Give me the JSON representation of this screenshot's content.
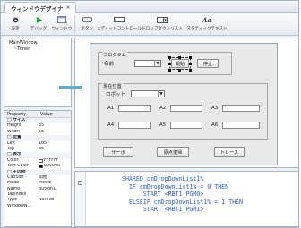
{
  "window": {
    "tab_title": "ウィンドウデザイナ",
    "close_glyph": "×"
  },
  "toolbar": {
    "items": [
      {
        "name": "settings",
        "icon": "gear-icon",
        "label": "設定"
      },
      {
        "name": "debug",
        "icon": "play-icon",
        "label": "デバッグ"
      },
      {
        "name": "window",
        "icon": "add-window-icon",
        "label": "ウィンドウ"
      },
      {
        "name": "button",
        "icon": "button-icon",
        "label": "ボタン"
      },
      {
        "name": "edit-control",
        "icon": "textbox-icon",
        "label": "エディットコントロール"
      },
      {
        "name": "dropdown-list",
        "icon": "dropdown-icon",
        "label": "ドロップダウンリスト"
      },
      {
        "name": "static-text",
        "icon": "text-icon",
        "label": "スタティックテキスト"
      }
    ]
  },
  "tree": {
    "items": [
      "MainWindow",
      "Timer"
    ]
  },
  "props": {
    "header": {
      "property": "Property",
      "value": "Value"
    },
    "rows": [
      {
        "k": "□ サイズ",
        "v": "",
        "cat": true
      },
      {
        "k": "Height",
        "v": "35"
      },
      {
        "k": "Width",
        "v": "55"
      },
      {
        "k": "□ 位置",
        "v": "",
        "cat": true
      },
      {
        "k": "Left",
        "v": "185"
      },
      {
        "k": "Top",
        "v": "35"
      },
      {
        "k": "□ 表示",
        "v": "",
        "cat": true
      },
      {
        "k": "Color",
        "v": "FFFFFF",
        "swatch": "#ffffff"
      },
      {
        "k": "Text Color",
        "v": "000000",
        "swatch": "#000000"
      },
      {
        "k": "□ その他",
        "v": "",
        "cat": true
      },
      {
        "k": "Caption",
        "v": "開始"
      },
      {
        "k": "Mode",
        "v": "Modal"
      },
      {
        "k": "Name",
        "v": "Button1"
      },
      {
        "k": "TabIndex",
        "v": ""
      },
      {
        "k": "Type",
        "v": "Normal"
      },
      {
        "k": "WindowN...",
        "v": ""
      }
    ]
  },
  "form": {
    "program_group": "プログラム",
    "name_label": "名前",
    "start_button": "開始",
    "stop_button": "停止",
    "position_group": "現在位置",
    "robot_label": "ロボット",
    "axes": [
      "A1",
      "A2",
      "A3",
      "A4",
      "A5",
      "A6"
    ],
    "servo_button": "サーボ",
    "origin_button": "原点復帰",
    "trace_button": "トレース"
  },
  "code": {
    "lines": [
      [
        {
          "t": "SHARED cmDropDownList1%",
          "c": "kw"
        }
      ],
      [
        {
          "t": "  IF ",
          "c": "kw"
        },
        {
          "t": "cmDropDownList1% = 0 THEN",
          "c": "kw"
        }
      ],
      [
        {
          "t": "      START <RBT1_PGM0>",
          "c": "kw"
        }
      ],
      [
        {
          "t": "  ELSEIF ",
          "c": "kw"
        },
        {
          "t": "cmDropDownList1% = 1 THEN",
          "c": "kw"
        }
      ],
      [
        {
          "t": "      START <RBT1_PGM1>",
          "c": "kw"
        }
      ]
    ]
  },
  "colors": {
    "accent": "#5aaed6",
    "code_text": "#2b5fd9",
    "code_marker": "#c8281e"
  }
}
